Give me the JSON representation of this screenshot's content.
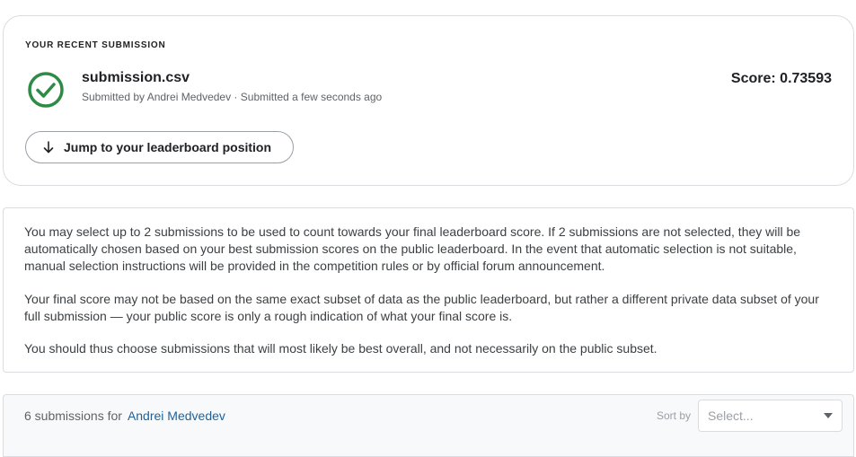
{
  "recent_submission": {
    "section_label": "YOUR RECENT SUBMISSION",
    "file_name": "submission.csv",
    "meta": "Submitted by Andrei Medvedev · Submitted a few seconds ago",
    "score_text": "Score: 0.73593",
    "status_icon": "check-circle-icon",
    "status_color": "#2e8b46",
    "jump_button_label": "Jump to your leaderboard position",
    "jump_icon": "arrow-down-icon"
  },
  "info": {
    "paragraph_1": "You may select up to 2 submissions to be used to count towards your final leaderboard score. If 2 submissions are not selected, they will be automatically chosen based on your best submission scores on the public leaderboard. In the event that automatic selection is not suitable, manual selection instructions will be provided in the competition rules or by official forum announcement.",
    "paragraph_2": "Your final score may not be based on the same exact subset of data as the public leaderboard, but rather a different private data subset of your full submission — your public score is only a rough indication of what your final score is.",
    "paragraph_3": "You should thus choose submissions that will most likely be best overall, and not necessarily on the public subset."
  },
  "submissions_list": {
    "count_text": "6 submissions for",
    "user_name": "Andrei Medvedev",
    "link_color": "#20639b",
    "sort_label": "Sort by",
    "sort_placeholder": "Select..."
  }
}
